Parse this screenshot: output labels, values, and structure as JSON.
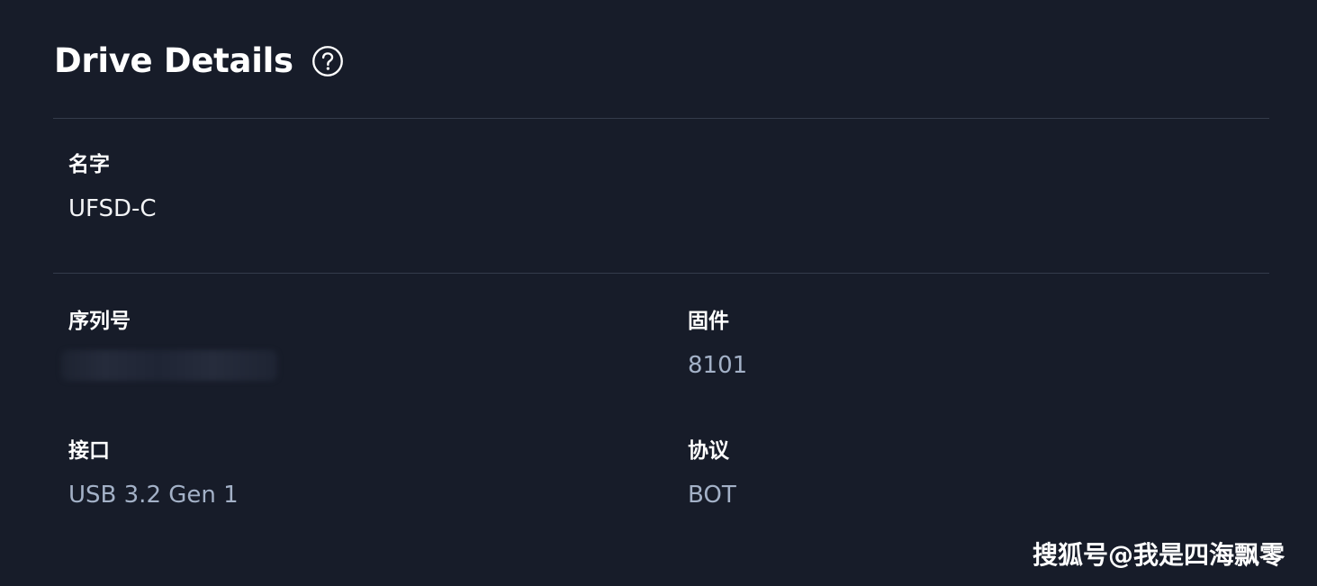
{
  "header": {
    "title": "Drive Details",
    "help_icon": "question-circle-icon"
  },
  "name_section": {
    "label": "名字",
    "value": "UFSD-C"
  },
  "details": {
    "serial": {
      "label": "序列号",
      "value_hidden": true
    },
    "firmware": {
      "label": "固件",
      "value": "8101"
    },
    "interface": {
      "label": "接口",
      "value": "USB 3.2 Gen 1"
    },
    "protocol": {
      "label": "协议",
      "value": "BOT"
    }
  },
  "watermark": "搜狐号@我是四海飘零",
  "colors": {
    "background": "#171c29",
    "divider": "#343b4b",
    "label": "#ffffff",
    "value_muted": "#a3b1c7"
  }
}
